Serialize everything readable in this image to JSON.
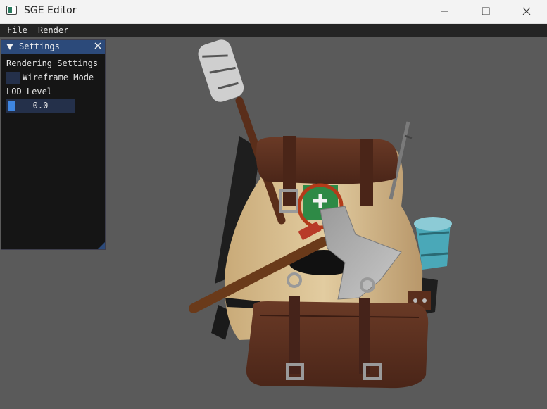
{
  "window": {
    "title": "SGE Editor",
    "controls": {
      "minimize": "minimize-icon",
      "maximize": "maximize-icon",
      "close": "close-icon"
    }
  },
  "menubar": {
    "items": [
      {
        "label": "File"
      },
      {
        "label": "Render"
      }
    ]
  },
  "settings_panel": {
    "title": "Settings",
    "section_label": "Rendering Settings",
    "wireframe": {
      "label": "Wireframe Mode",
      "checked": false
    },
    "lod": {
      "label": "LOD Level",
      "value": "0.0"
    }
  },
  "viewport": {
    "background": "#5a5a5a",
    "model": "backpack-3d-model"
  },
  "colors": {
    "imgui_header": "#2c4a7a",
    "imgui_frame": "#24304a",
    "imgui_window_bg": "#151515",
    "slider_grab": "#3f86e0"
  }
}
